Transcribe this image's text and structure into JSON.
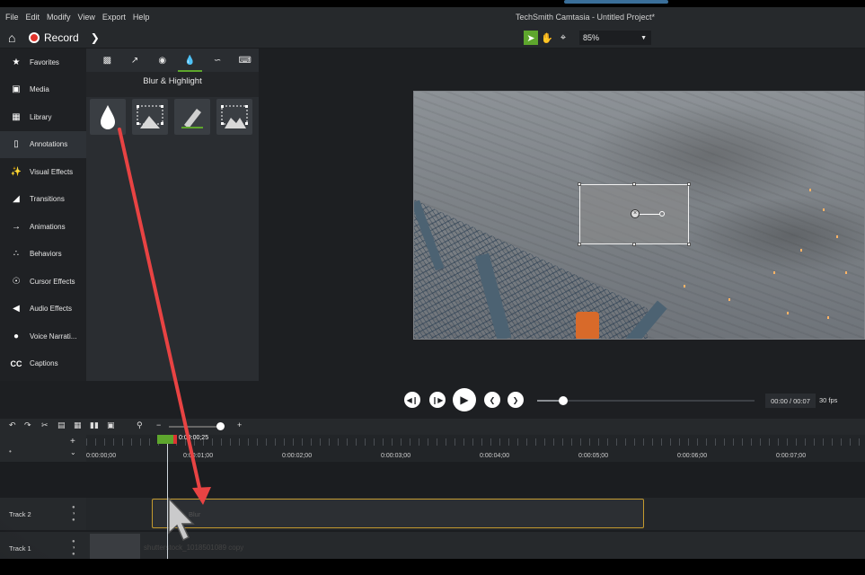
{
  "window": {
    "title": "TechSmith Camtasia - Untitled Project*"
  },
  "menu": [
    "File",
    "Edit",
    "Modify",
    "View",
    "Export",
    "Help"
  ],
  "toolbar": {
    "record_label": "Record",
    "zoom_value": "85%"
  },
  "sidebar": {
    "items": [
      {
        "label": "Favorites",
        "icon": "star-icon"
      },
      {
        "label": "Media",
        "icon": "film-icon"
      },
      {
        "label": "Library",
        "icon": "library-icon"
      },
      {
        "label": "Annotations",
        "icon": "annotation-icon",
        "active": true
      },
      {
        "label": "Visual Effects",
        "icon": "wand-icon"
      },
      {
        "label": "Transitions",
        "icon": "transition-icon"
      },
      {
        "label": "Animations",
        "icon": "animation-arrow-icon"
      },
      {
        "label": "Behaviors",
        "icon": "behaviors-icon"
      },
      {
        "label": "Cursor Effects",
        "icon": "cursor-effects-icon"
      },
      {
        "label": "Audio Effects",
        "icon": "speaker-icon"
      },
      {
        "label": "Voice Narrati...",
        "icon": "microphone-icon"
      },
      {
        "label": "Captions",
        "icon": "cc-icon"
      }
    ]
  },
  "panel": {
    "title": "Blur & Highlight",
    "tabs": [
      "callout-tab-icon",
      "arrow-tab-icon",
      "shape-tab-icon",
      "blur-tab-icon",
      "sketch-tab-icon",
      "keystroke-tab-icon"
    ],
    "active_tab": 3,
    "thumbnails": [
      "blur-drop-icon",
      "spotlight-icon",
      "highlight-icon",
      "pixelate-icon"
    ]
  },
  "playback": {
    "timecode": "00:00 / 00:07",
    "fps": "30 fps",
    "progress": 0.12
  },
  "timeline": {
    "playhead_time": "0:00:00;25",
    "ruler_labels": [
      "0:00:00;00",
      "0:00:01;00",
      "0:00:02;00",
      "0:00:03;00",
      "0:00:04;00",
      "0:00:05;00",
      "0:00:06;00",
      "0:00:07;00"
    ],
    "tracks": [
      {
        "name": "Track 2",
        "clip_label": "Blur"
      },
      {
        "name": "Track 1",
        "clip_label": "shutterstock_1018501089 copy"
      }
    ]
  },
  "colors": {
    "accent_green": "#5ea62d",
    "record_red": "#e0332b",
    "clip_border": "#c49a2e",
    "arrow_red": "#e84343"
  }
}
